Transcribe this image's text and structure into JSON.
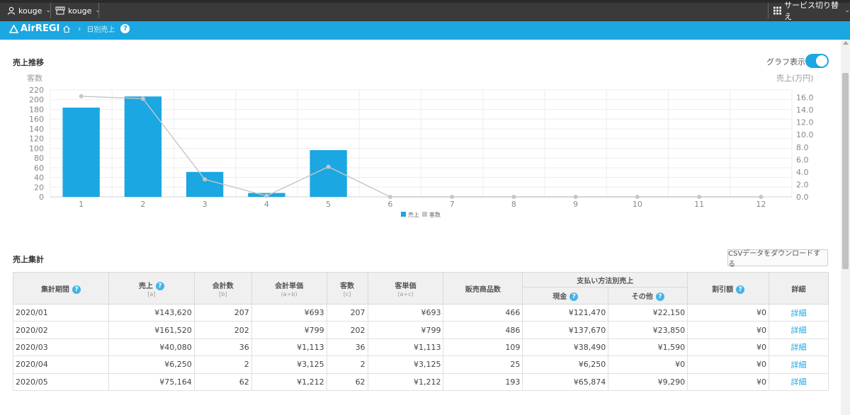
{
  "topbar": {
    "user": "kouge",
    "store": "kouge",
    "service_switch": "サービス切り替え"
  },
  "header": {
    "logo": "AirREGI",
    "breadcrumb": "日別売上",
    "help": "?"
  },
  "chart_section": {
    "title": "売上推移",
    "toggle_label": "グラフ表示",
    "toggle_on": true
  },
  "chart_data": {
    "type": "bar",
    "categories": [
      "1",
      "2",
      "3",
      "4",
      "5",
      "6",
      "7",
      "8",
      "9",
      "10",
      "11",
      "12"
    ],
    "series": [
      {
        "name": "売上",
        "kind": "bar",
        "axis": "right",
        "color": "#1ba7e1",
        "values": [
          14.36,
          16.15,
          4.01,
          0.63,
          7.52,
          0,
          0,
          0,
          0,
          0,
          0,
          0
        ]
      },
      {
        "name": "客数",
        "kind": "line",
        "axis": "left",
        "color": "#c6c6c6",
        "values": [
          207,
          202,
          36,
          2,
          62,
          0,
          0,
          0,
          0,
          0,
          0,
          0
        ]
      }
    ],
    "ylabel_left": "客数",
    "ylabel_right": "売上(万円)",
    "ylim_left": [
      0,
      220
    ],
    "yticks_left": [
      "0",
      "20",
      "40",
      "60",
      "80",
      "100",
      "120",
      "140",
      "160",
      "180",
      "200",
      "220"
    ],
    "ylim_right": [
      0,
      17.2
    ],
    "yticks_right": [
      "0.0",
      "2.0",
      "4.0",
      "6.0",
      "8.0",
      "10.0",
      "12.0",
      "14.0",
      "16.0"
    ],
    "grid": true,
    "legend_position": "bottom"
  },
  "summary": {
    "title": "売上集計",
    "csv_button": "CSVデータをダウンロードする",
    "headers": {
      "period": "集計期間",
      "sales": "売上",
      "sales_sub": "[a]",
      "count": "会計数",
      "count_sub": "[b]",
      "unit_price": "会計単価",
      "unit_price_sub": "(a÷b)",
      "customers": "客数",
      "customers_sub": "[c]",
      "customer_price": "客単価",
      "customer_price_sub": "(a÷c)",
      "items": "販売商品数",
      "payment": "支払い方法別売上",
      "cash": "現金",
      "other": "その他",
      "discount": "割引額",
      "detail": "詳細"
    },
    "rows": [
      {
        "period": "2020/01",
        "sales": "¥143,620",
        "count": "207",
        "unit": "¥693",
        "cust": "207",
        "cprice": "¥693",
        "items": "466",
        "cash": "¥121,470",
        "other": "¥22,150",
        "disc": "¥0",
        "detail": "詳細"
      },
      {
        "period": "2020/02",
        "sales": "¥161,520",
        "count": "202",
        "unit": "¥799",
        "cust": "202",
        "cprice": "¥799",
        "items": "486",
        "cash": "¥137,670",
        "other": "¥23,850",
        "disc": "¥0",
        "detail": "詳細"
      },
      {
        "period": "2020/03",
        "sales": "¥40,080",
        "count": "36",
        "unit": "¥1,113",
        "cust": "36",
        "cprice": "¥1,113",
        "items": "109",
        "cash": "¥38,490",
        "other": "¥1,590",
        "disc": "¥0",
        "detail": "詳細"
      },
      {
        "period": "2020/04",
        "sales": "¥6,250",
        "count": "2",
        "unit": "¥3,125",
        "cust": "2",
        "cprice": "¥3,125",
        "items": "25",
        "cash": "¥6,250",
        "other": "¥0",
        "disc": "¥0",
        "detail": "詳細"
      },
      {
        "period": "2020/05",
        "sales": "¥75,164",
        "count": "62",
        "unit": "¥1,212",
        "cust": "62",
        "cprice": "¥1,212",
        "items": "193",
        "cash": "¥65,874",
        "other": "¥9,290",
        "disc": "¥0",
        "detail": "詳細"
      }
    ]
  }
}
